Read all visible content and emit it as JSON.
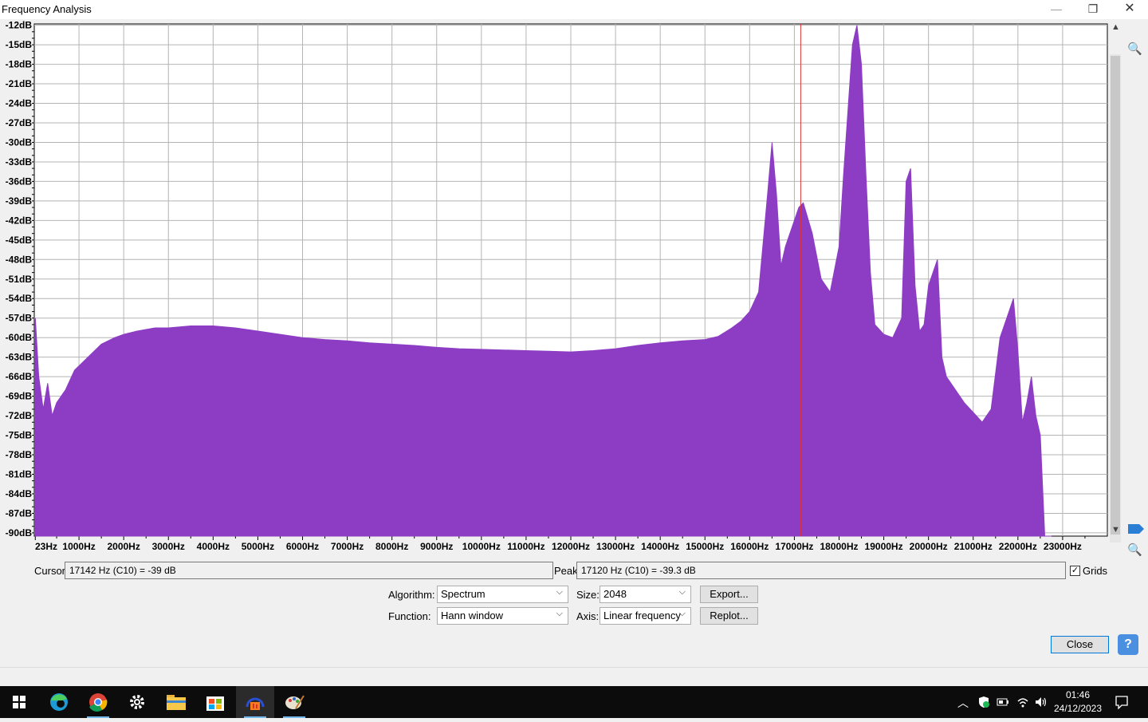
{
  "window": {
    "title": "Frequency Analysis",
    "minimize": "—",
    "maximize": "❐",
    "close": "✕"
  },
  "chart_data": {
    "type": "area",
    "title": "",
    "xlabel": "",
    "ylabel": "",
    "xlim": [
      0,
      24000
    ],
    "ylim": [
      -90.5,
      -11.8
    ],
    "grid": true,
    "fill_color": "#8d3cc4",
    "cursor_color": "#e03030",
    "cursor_x": 17142,
    "y_ticks": [
      "-12dB",
      "-15dB",
      "-18dB",
      "-21dB",
      "-24dB",
      "-27dB",
      "-30dB",
      "-33dB",
      "-36dB",
      "-39dB",
      "-42dB",
      "-45dB",
      "-48dB",
      "-51dB",
      "-54dB",
      "-57dB",
      "-60dB",
      "-63dB",
      "-66dB",
      "-69dB",
      "-72dB",
      "-75dB",
      "-78dB",
      "-81dB",
      "-84dB",
      "-87dB",
      "-90dB"
    ],
    "x_ticks": [
      "23Hz",
      "1000Hz",
      "2000Hz",
      "3000Hz",
      "4000Hz",
      "5000Hz",
      "6000Hz",
      "7000Hz",
      "8000Hz",
      "9000Hz",
      "10000Hz",
      "11000Hz",
      "12000Hz",
      "13000Hz",
      "14000Hz",
      "15000Hz",
      "16000Hz",
      "17000Hz",
      "18000Hz",
      "19000Hz",
      "20000Hz",
      "21000Hz",
      "22000Hz",
      "23000Hz"
    ],
    "series": [
      {
        "x": [
          23,
          100,
          200,
          300,
          400,
          500,
          700,
          900,
          1200,
          1500,
          1800,
          2000,
          2300,
          2700,
          3000,
          3500,
          4000,
          4500,
          5000,
          5500,
          6000,
          6500,
          7000,
          7500,
          8000,
          8500,
          9000,
          9500,
          10000,
          10500,
          11000,
          11500,
          12000,
          12500,
          13000,
          13500,
          14000,
          14500,
          15000,
          15300,
          15600,
          15800,
          16000,
          16200,
          16400,
          16500,
          16600,
          16700,
          16800,
          17000,
          17100,
          17200,
          17400,
          17600,
          17800,
          18000,
          18100,
          18200,
          18300,
          18400,
          18500,
          18600,
          18700,
          18800,
          19000,
          19200,
          19400,
          19500,
          19600,
          19700,
          19800,
          19900,
          20000,
          20100,
          20200,
          20300,
          20400,
          20500,
          20800,
          21000,
          21200,
          21400,
          21600,
          21800,
          21900,
          22000,
          22100,
          22200,
          22300,
          22400,
          22500,
          22600,
          22700,
          22750
        ],
        "y": [
          -57,
          -66,
          -71,
          -67,
          -72,
          -70,
          -68,
          -65,
          -63,
          -61,
          -60,
          -59.5,
          -59,
          -58.5,
          -58.5,
          -58.2,
          -58.2,
          -58.5,
          -59,
          -59.5,
          -60,
          -60.3,
          -60.5,
          -60.8,
          -61,
          -61.2,
          -61.5,
          -61.7,
          -61.8,
          -61.9,
          -62,
          -62.1,
          -62.2,
          -62,
          -61.7,
          -61.2,
          -60.8,
          -60.5,
          -60.3,
          -59.8,
          -58.5,
          -57.5,
          -56,
          -53,
          -38,
          -30,
          -38,
          -49,
          -46,
          -42,
          -40,
          -39.3,
          -44,
          -51,
          -53,
          -46,
          -35,
          -25,
          -15,
          -12,
          -18,
          -35,
          -50,
          -58,
          -59.5,
          -60,
          -57,
          -36,
          -34,
          -52,
          -59,
          -58,
          -52,
          -50,
          -48,
          -63,
          -66,
          -67,
          -70,
          -71.5,
          -73,
          -71,
          -60,
          -56,
          -54,
          -62,
          -73,
          -70,
          -66,
          -72,
          -75,
          -90.5,
          -90.5,
          -90.5
        ]
      }
    ]
  },
  "cursor": {
    "label": "Cursor:",
    "value": "17142 Hz (C10) = -39 dB"
  },
  "peak": {
    "label": "Peak:",
    "value": "17120 Hz (C10) = -39.3 dB"
  },
  "grids": {
    "label": "Grids",
    "checked": "✓"
  },
  "algorithm": {
    "label": "Algorithm:",
    "value": "Spectrum"
  },
  "size": {
    "label": "Size:",
    "value": "2048"
  },
  "function": {
    "label": "Function:",
    "value": "Hann window"
  },
  "axis": {
    "label": "Axis:",
    "value": "Linear frequency"
  },
  "buttons": {
    "export": "Export...",
    "replot": "Replot...",
    "close": "Close",
    "help": "?"
  },
  "clock": {
    "time": "01:46",
    "date": "24/12/2023"
  }
}
